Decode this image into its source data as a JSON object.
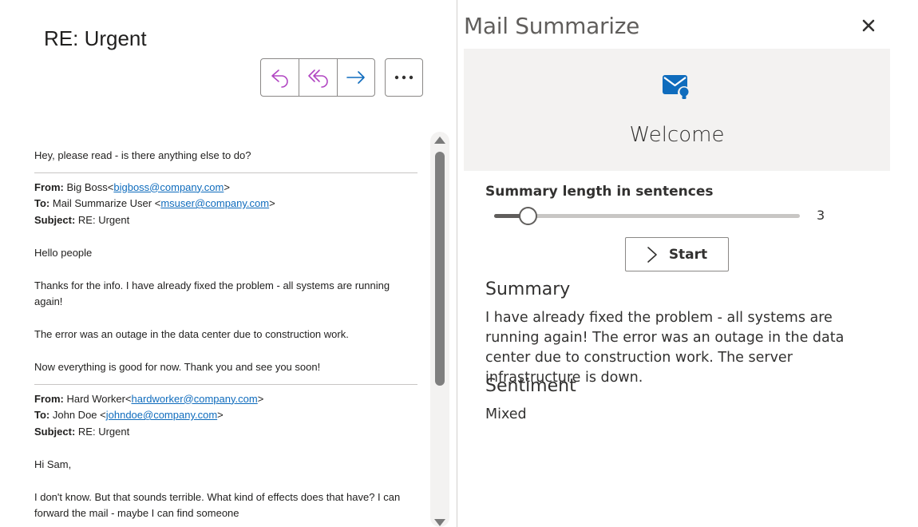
{
  "email": {
    "subject": "RE: Urgent",
    "actions": {
      "reply": "reply-icon",
      "reply_all": "reply-all-icon",
      "forward": "forward-icon",
      "more": "more-icon"
    },
    "intro": "Hey, please read - is there anything else to do?",
    "quoted": [
      {
        "from_label": "From:",
        "from_name": "Big Boss<",
        "from_email": "bigboss@company.com",
        "to_label": "To:",
        "to_name": "Mail Summarize User <",
        "to_email": "msuser@company.com",
        "subject_label": "Subject:",
        "subject": "RE: Urgent",
        "paragraphs": [
          "Hello people",
          "Thanks for the info. I have already fixed the problem - all systems are running again!",
          "The error was an outage in the data center due to construction work.",
          "Now everything is good for now. Thank you and see you soon!"
        ]
      },
      {
        "from_label": "From:",
        "from_name": "Hard Worker<",
        "from_email": "hardworker@company.com",
        "to_label": "To:",
        "to_name": "John Doe <",
        "to_email": "johndoe@company.com",
        "subject_label": "Subject:",
        "subject": "RE: Urgent",
        "paragraphs": [
          "Hi Sam,",
          "I don't know. But that sounds terrible. What kind of effects does that have? I can forward the mail - maybe I can find someone"
        ]
      }
    ]
  },
  "addin": {
    "title": "Mail Summarize",
    "close_icon": "close-icon",
    "welcome_icon": "mail-lightbulb-icon",
    "welcome": "Welcome",
    "slider": {
      "label": "Summary length in sentences",
      "value": 3,
      "value_text": "3",
      "fraction": 0.11
    },
    "start_button": "Start",
    "summary_heading": "Summary",
    "summary_text": "I have already fixed the problem - all systems are running again! The error was an outage in the data center due to construction work. The server infrastructure is down.",
    "sentiment_heading": "Sentiment",
    "sentiment_value": "Mixed"
  }
}
